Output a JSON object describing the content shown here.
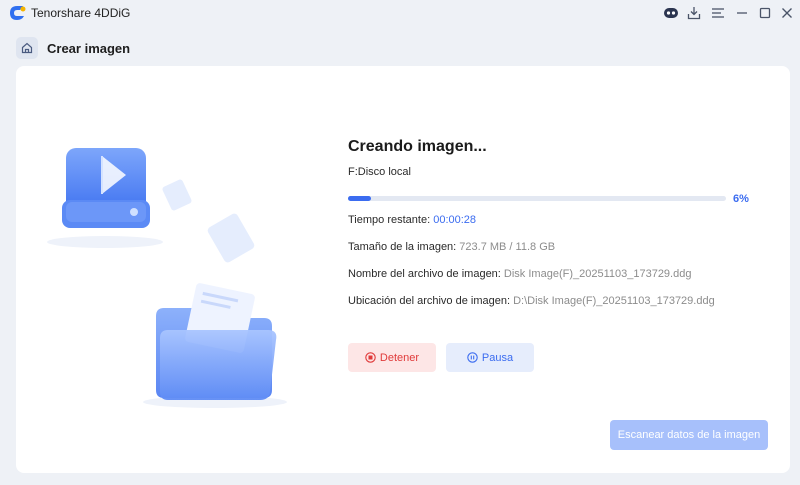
{
  "app": {
    "title": "Tenorshare 4DDiG"
  },
  "titlebar": {
    "icons": [
      "ai-assistant-icon",
      "download-icon",
      "menu-icon",
      "minimize-icon",
      "maximize-icon",
      "close-icon"
    ]
  },
  "header": {
    "title": "Crear imagen"
  },
  "progress": {
    "title": "Creando imagen...",
    "drive": "F:Disco local",
    "fraction": 0.06,
    "percent_label": "6%"
  },
  "details": {
    "time_label": "Tiempo restante:",
    "time_value": "00:00:28",
    "size_label": "Tamaño de la imagen:",
    "size_value": "723.7 MB / 11.8 GB",
    "filename_label": "Nombre del archivo de imagen:",
    "filename_value": "Disk Image(F)_20251103_173729.ddg",
    "location_label": "Ubicación del archivo de imagen:",
    "location_value": "D:\\Disk Image(F)_20251103_173729.ddg"
  },
  "buttons": {
    "stop": "Detener",
    "pause": "Pausa",
    "scan": "Escanear datos de la imagen"
  },
  "colors": {
    "accent": "#3b6cf0",
    "stop": "#e03a3a",
    "scan_disabled": "#a7c0fb"
  }
}
